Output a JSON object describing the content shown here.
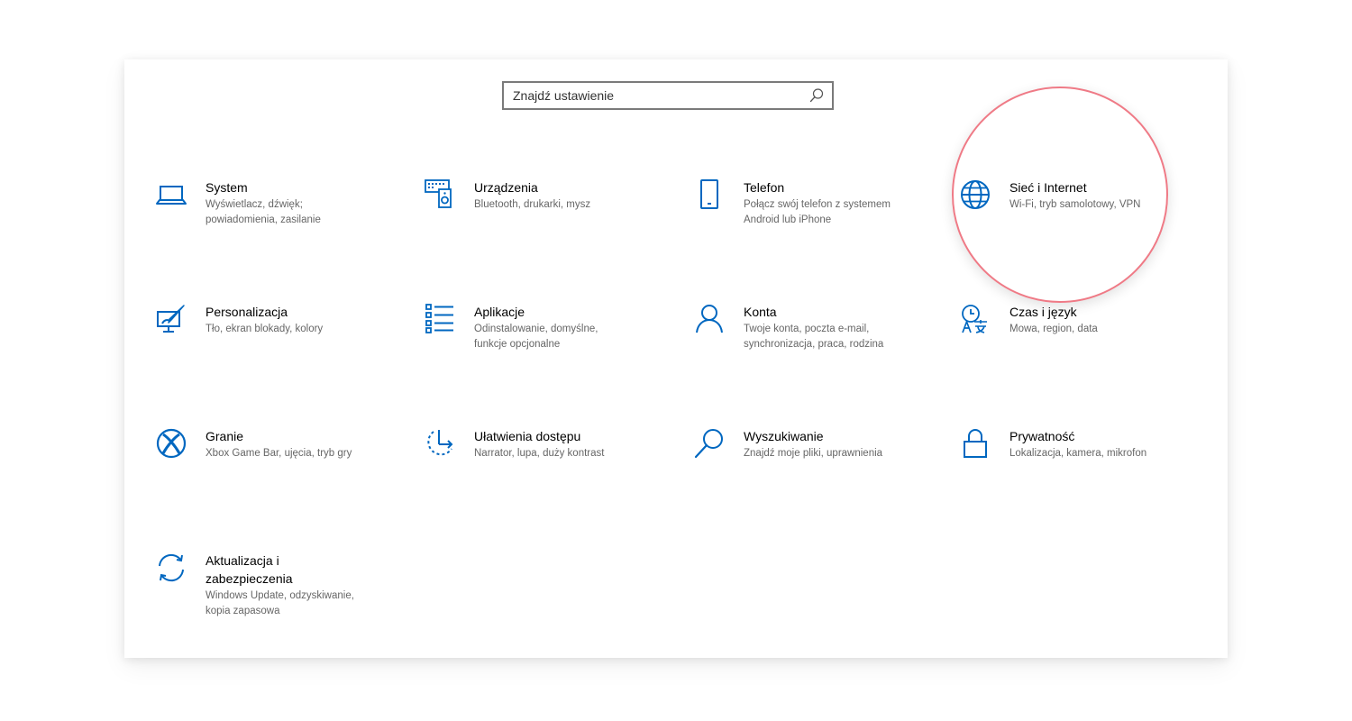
{
  "search": {
    "placeholder": "Znajdź ustawienie",
    "value": ""
  },
  "accent_color": "#0067c0",
  "highlight_color": "#ef7a86",
  "tiles": [
    {
      "key": "system",
      "icon": "laptop-icon",
      "title": "System",
      "desc": "Wyświetlacz, dźwięk; powiadomienia, zasilanie"
    },
    {
      "key": "devices",
      "icon": "keyboard-speaker-icon",
      "title": "Urządzenia",
      "desc": "Bluetooth, drukarki, mysz"
    },
    {
      "key": "phone",
      "icon": "phone-icon",
      "title": "Telefon",
      "desc": "Połącz swój telefon z systemem Android lub iPhone"
    },
    {
      "key": "network",
      "icon": "globe-icon",
      "title": "Sieć i Internet",
      "desc": "Wi-Fi, tryb samolotowy, VPN"
    },
    {
      "key": "personalization",
      "icon": "paint-brush-icon",
      "title": "Personalizacja",
      "desc": "Tło, ekran blokady, kolory"
    },
    {
      "key": "apps",
      "icon": "apps-list-icon",
      "title": "Aplikacje",
      "desc": "Odinstalowanie, domyślne, funkcje opcjonalne"
    },
    {
      "key": "accounts",
      "icon": "person-icon",
      "title": "Konta",
      "desc": "Twoje konta, poczta e-mail, synchronizacja, praca, rodzina"
    },
    {
      "key": "time-language",
      "icon": "time-language-icon",
      "title": "Czas i język",
      "desc": "Mowa, region, data"
    },
    {
      "key": "gaming",
      "icon": "xbox-icon",
      "title": "Granie",
      "desc": "Xbox Game Bar, ujęcia, tryb gry"
    },
    {
      "key": "ease-of-access",
      "icon": "ease-of-access-icon",
      "title": "Ułatwienia dostępu",
      "desc": "Narrator, lupa, duży kontrast"
    },
    {
      "key": "search",
      "icon": "magnifier-icon",
      "title": "Wyszukiwanie",
      "desc": "Znajdź moje pliki, uprawnienia"
    },
    {
      "key": "privacy",
      "icon": "lock-icon",
      "title": "Prywatność",
      "desc": "Lokalizacja, kamera, mikrofon"
    },
    {
      "key": "update-security",
      "icon": "sync-arrows-icon",
      "title": "Aktualizacja i zabezpieczenia",
      "desc": "Windows Update, odzyskiwanie, kopia zapasowa"
    }
  ]
}
